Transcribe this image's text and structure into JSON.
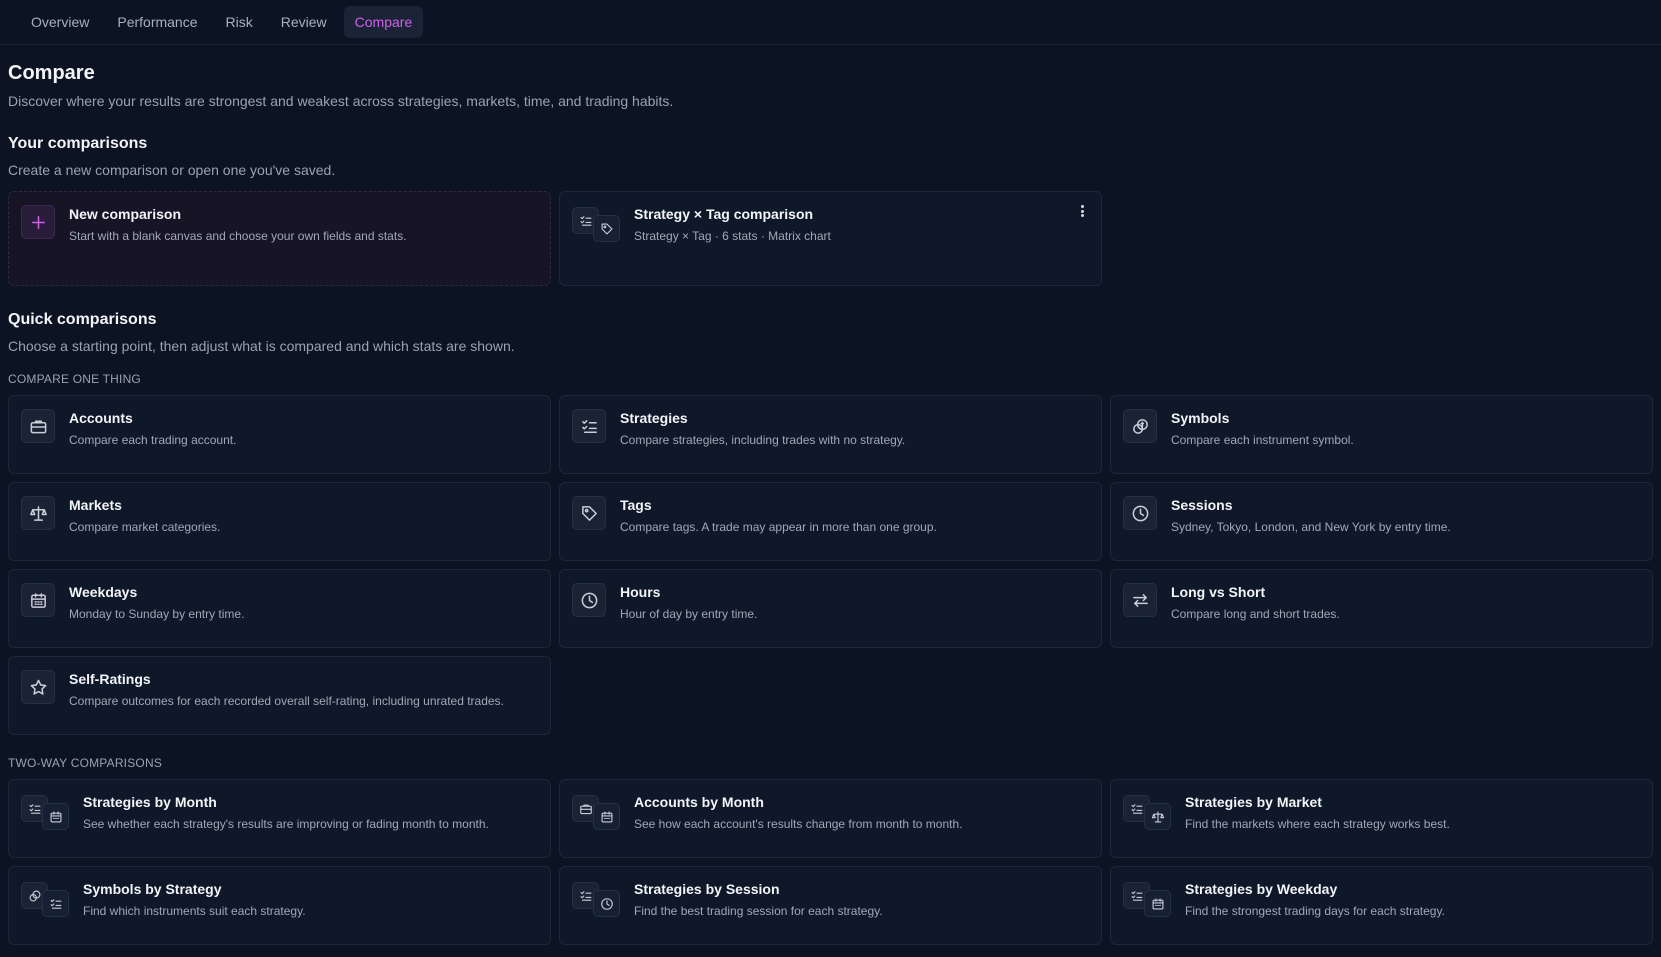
{
  "nav": {
    "tabs": [
      {
        "label": "Overview"
      },
      {
        "label": "Performance"
      },
      {
        "label": "Risk"
      },
      {
        "label": "Review"
      },
      {
        "label": "Compare"
      }
    ],
    "active_tab": "Compare"
  },
  "header": {
    "title": "Compare",
    "subtitle": "Discover where your results are strongest and weakest across strategies, markets, time, and trading habits."
  },
  "your_comparisons": {
    "title": "Your comparisons",
    "subtitle": "Create a new comparison or open one you've saved.",
    "new_card": {
      "title": "New comparison",
      "desc": "Start with a blank canvas and choose your own fields and stats.",
      "icon": "plus-icon"
    },
    "saved": [
      {
        "title": "Strategy × Tag comparison",
        "desc": "Strategy × Tag · 6 stats · Matrix chart",
        "icons": [
          "checklist-icon",
          "tag-icon"
        ]
      }
    ]
  },
  "quick": {
    "title": "Quick comparisons",
    "subtitle": "Choose a starting point, then adjust what is compared and which stats are shown.",
    "one_thing_caption": "COMPARE ONE THING",
    "one_thing": [
      {
        "title": "Accounts",
        "desc": "Compare each trading account.",
        "icon": "briefcase-icon"
      },
      {
        "title": "Strategies",
        "desc": "Compare strategies, including trades with no strategy.",
        "icon": "checklist-icon"
      },
      {
        "title": "Symbols",
        "desc": "Compare each instrument symbol.",
        "icon": "coins-icon"
      },
      {
        "title": "Markets",
        "desc": "Compare market categories.",
        "icon": "scale-icon"
      },
      {
        "title": "Tags",
        "desc": "Compare tags. A trade may appear in more than one group.",
        "icon": "tag-icon"
      },
      {
        "title": "Sessions",
        "desc": "Sydney, Tokyo, London, and New York by entry time.",
        "icon": "clock-icon"
      },
      {
        "title": "Weekdays",
        "desc": "Monday to Sunday by entry time.",
        "icon": "calendar-icon"
      },
      {
        "title": "Hours",
        "desc": "Hour of day by entry time.",
        "icon": "clock-icon"
      },
      {
        "title": "Long vs Short",
        "desc": "Compare long and short trades.",
        "icon": "arrows-icon"
      },
      {
        "title": "Self-Ratings",
        "desc": "Compare outcomes for each recorded overall self-rating, including unrated trades.",
        "icon": "star-icon"
      }
    ],
    "two_way_caption": "TWO-WAY COMPARISONS",
    "two_way": [
      {
        "title": "Strategies by Month",
        "desc": "See whether each strategy's results are improving or fading month to month.",
        "icons": [
          "checklist-icon",
          "calendar-icon"
        ]
      },
      {
        "title": "Accounts by Month",
        "desc": "See how each account's results change from month to month.",
        "icons": [
          "briefcase-icon",
          "calendar-icon"
        ]
      },
      {
        "title": "Strategies by Market",
        "desc": "Find the markets where each strategy works best.",
        "icons": [
          "checklist-icon",
          "scale-icon"
        ]
      },
      {
        "title": "Symbols by Strategy",
        "desc": "Find which instruments suit each strategy.",
        "icons": [
          "coins-icon",
          "checklist-icon"
        ]
      },
      {
        "title": "Strategies by Session",
        "desc": "Find the best trading session for each strategy.",
        "icons": [
          "checklist-icon",
          "clock-icon"
        ]
      },
      {
        "title": "Strategies by Weekday",
        "desc": "Find the strongest trading days for each strategy.",
        "icons": [
          "checklist-icon",
          "calendar-icon"
        ]
      }
    ]
  },
  "colors": {
    "background": "#0c1322",
    "card": "#0f1829",
    "accent": "#d061e8",
    "muted_text": "#9aa3b2"
  }
}
